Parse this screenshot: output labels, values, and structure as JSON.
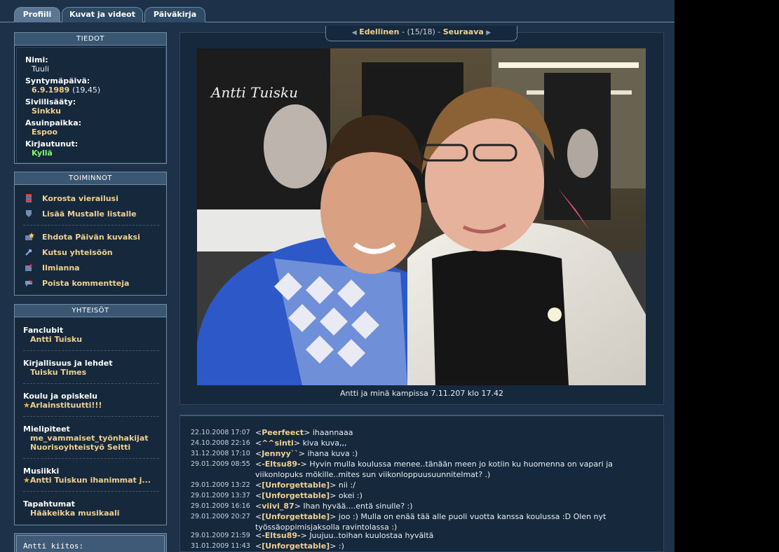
{
  "tabs": [
    "Profiili",
    "Kuvat ja videot",
    "Päiväkirja"
  ],
  "info": {
    "header": "TIEDOT",
    "name_label": "Nimi:",
    "name": "Tuuli",
    "birthday_label": "Syntymäpäivä:",
    "birthday": "6.9.1989",
    "age": "(19,45)",
    "status_label": "Siviilisääty:",
    "status": "Sinkku",
    "city_label": "Asuinpaikka:",
    "city": "Espoo",
    "logged_label": "Kirjautunut:",
    "logged": "Kyllä"
  },
  "actions": {
    "header": "TOIMINNOT",
    "items": [
      {
        "label": "Korosta vierailusi",
        "icon": "highlight-icon"
      },
      {
        "label": "Lisää Mustalle listalle",
        "icon": "shield-icon"
      },
      {
        "label": "Ehdota Päivän kuvaksi",
        "icon": "star-photo-icon"
      },
      {
        "label": "Kutsu yhteisöön",
        "icon": "invite-icon"
      },
      {
        "label": "Ilmianna",
        "icon": "report-icon"
      },
      {
        "label": "Poista kommentteja",
        "icon": "delete-comments-icon"
      }
    ]
  },
  "communities": {
    "header": "YHTEISÖT",
    "groups": [
      {
        "title": "Fanclubit",
        "items": [
          "Antti Tuisku"
        ]
      },
      {
        "title": "Kirjallisuus ja lehdet",
        "items": [
          "Tuisku Times"
        ]
      },
      {
        "title": "Koulu ja opiskelu",
        "items": [
          "Arlainstituutti!!!"
        ]
      },
      {
        "title": "Mielipiteet",
        "items": [
          "me_vammaiset_työnhakijat",
          "Nuorisoyhteistyö Seitti"
        ]
      },
      {
        "title": "Musiikki",
        "items": [
          "Antti Tuiskun ihanimmat j..."
        ]
      },
      {
        "title": "Tapahtumat",
        "items": [
          "Hääkeikka musikaali"
        ]
      }
    ]
  },
  "bottom_box": {
    "text": "Antti kiitos:"
  },
  "nav": {
    "prev": "Edellinen",
    "counter": "(15/18)",
    "next": "Seuraava"
  },
  "photo": {
    "caption": "Antti ja minä kampissa 7.11.207 klo 17.42",
    "poster_text": "Antti Tuisku"
  },
  "comments": [
    {
      "time": "22.10.2008 17:07",
      "nick": "Peerfeect",
      "text": "ihaannaaa"
    },
    {
      "time": "24.10.2008 22:16",
      "nick": "^^sinti",
      "text": "kiva kuva,,,"
    },
    {
      "time": "31.12.2008 17:10",
      "nick": "Jennyy``",
      "text": "ihana kuva :)"
    },
    {
      "time": "29.01.2009 08:55",
      "nick": "-Eltsu89-",
      "text": "Hyvin mulla koulussa menee..tänään meen jo kotiin ku huomenna on vapari ja viikonlopuks mökille..mites sun viikonloppuusuunnitelmat? .)"
    },
    {
      "time": "29.01.2009 13:22",
      "nick": "[Unforgettable]",
      "text": "nii :/"
    },
    {
      "time": "29.01.2009 13:37",
      "nick": "[Unforgettable]",
      "text": "okei :)"
    },
    {
      "time": "29.01.2009 16:16",
      "nick": "viivi_87",
      "text": "Ihan hyvää....entä sinulle? :)"
    },
    {
      "time": "29.01.2009 20:27",
      "nick": "[Unforgettable]",
      "text": "joo :) Mulla on enää tää alle puoli vuotta kanssa koulussa :D Olen nyt työssäoppimisjaksolla ravintolassa :)"
    },
    {
      "time": "29.01.2009 21:59",
      "nick": "-Eltsu89-",
      "text": "Juujuu..toihan kuulostaa hyvältä"
    },
    {
      "time": "31.01.2009 11:43",
      "nick": "[Unforgettable]",
      "text": ":)"
    }
  ]
}
